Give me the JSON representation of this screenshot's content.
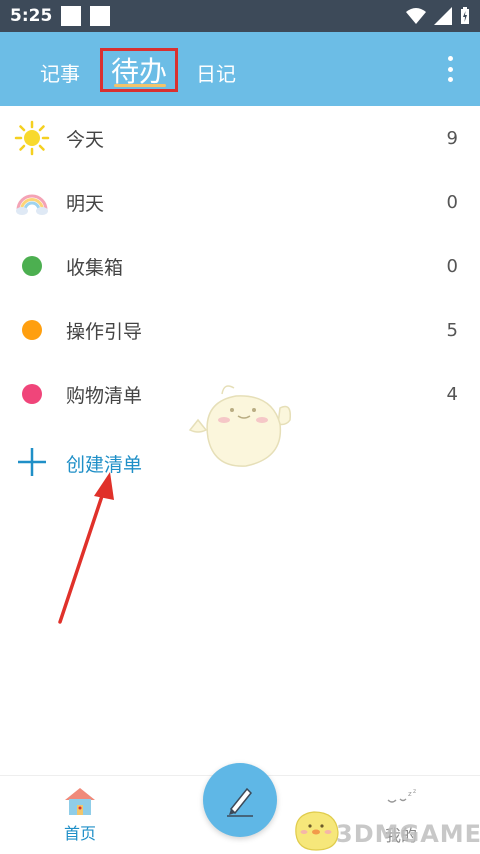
{
  "status_bar": {
    "time": "5:25"
  },
  "header": {
    "tabs": [
      {
        "label": "记事"
      },
      {
        "label": "待办"
      },
      {
        "label": "日记"
      }
    ],
    "active_tab": "待办",
    "accent_color": "#6cbde6"
  },
  "lists": {
    "items": [
      {
        "label": "今天",
        "count": "9",
        "icon": "sun-icon"
      },
      {
        "label": "明天",
        "count": "0",
        "icon": "rainbow-icon"
      },
      {
        "label": "收集箱",
        "count": "0",
        "icon": "green-dot-icon",
        "color": "#4caf50"
      },
      {
        "label": "操作引导",
        "count": "5",
        "icon": "orange-dot-icon",
        "color": "#ff9f0f"
      },
      {
        "label": "购物清单",
        "count": "4",
        "icon": "pink-dot-icon",
        "color": "#f0457a"
      }
    ],
    "create_label": "创建清单"
  },
  "bottom_nav": {
    "home_label": "首页",
    "mine_label": "我的"
  },
  "watermark": "3DMGAME"
}
